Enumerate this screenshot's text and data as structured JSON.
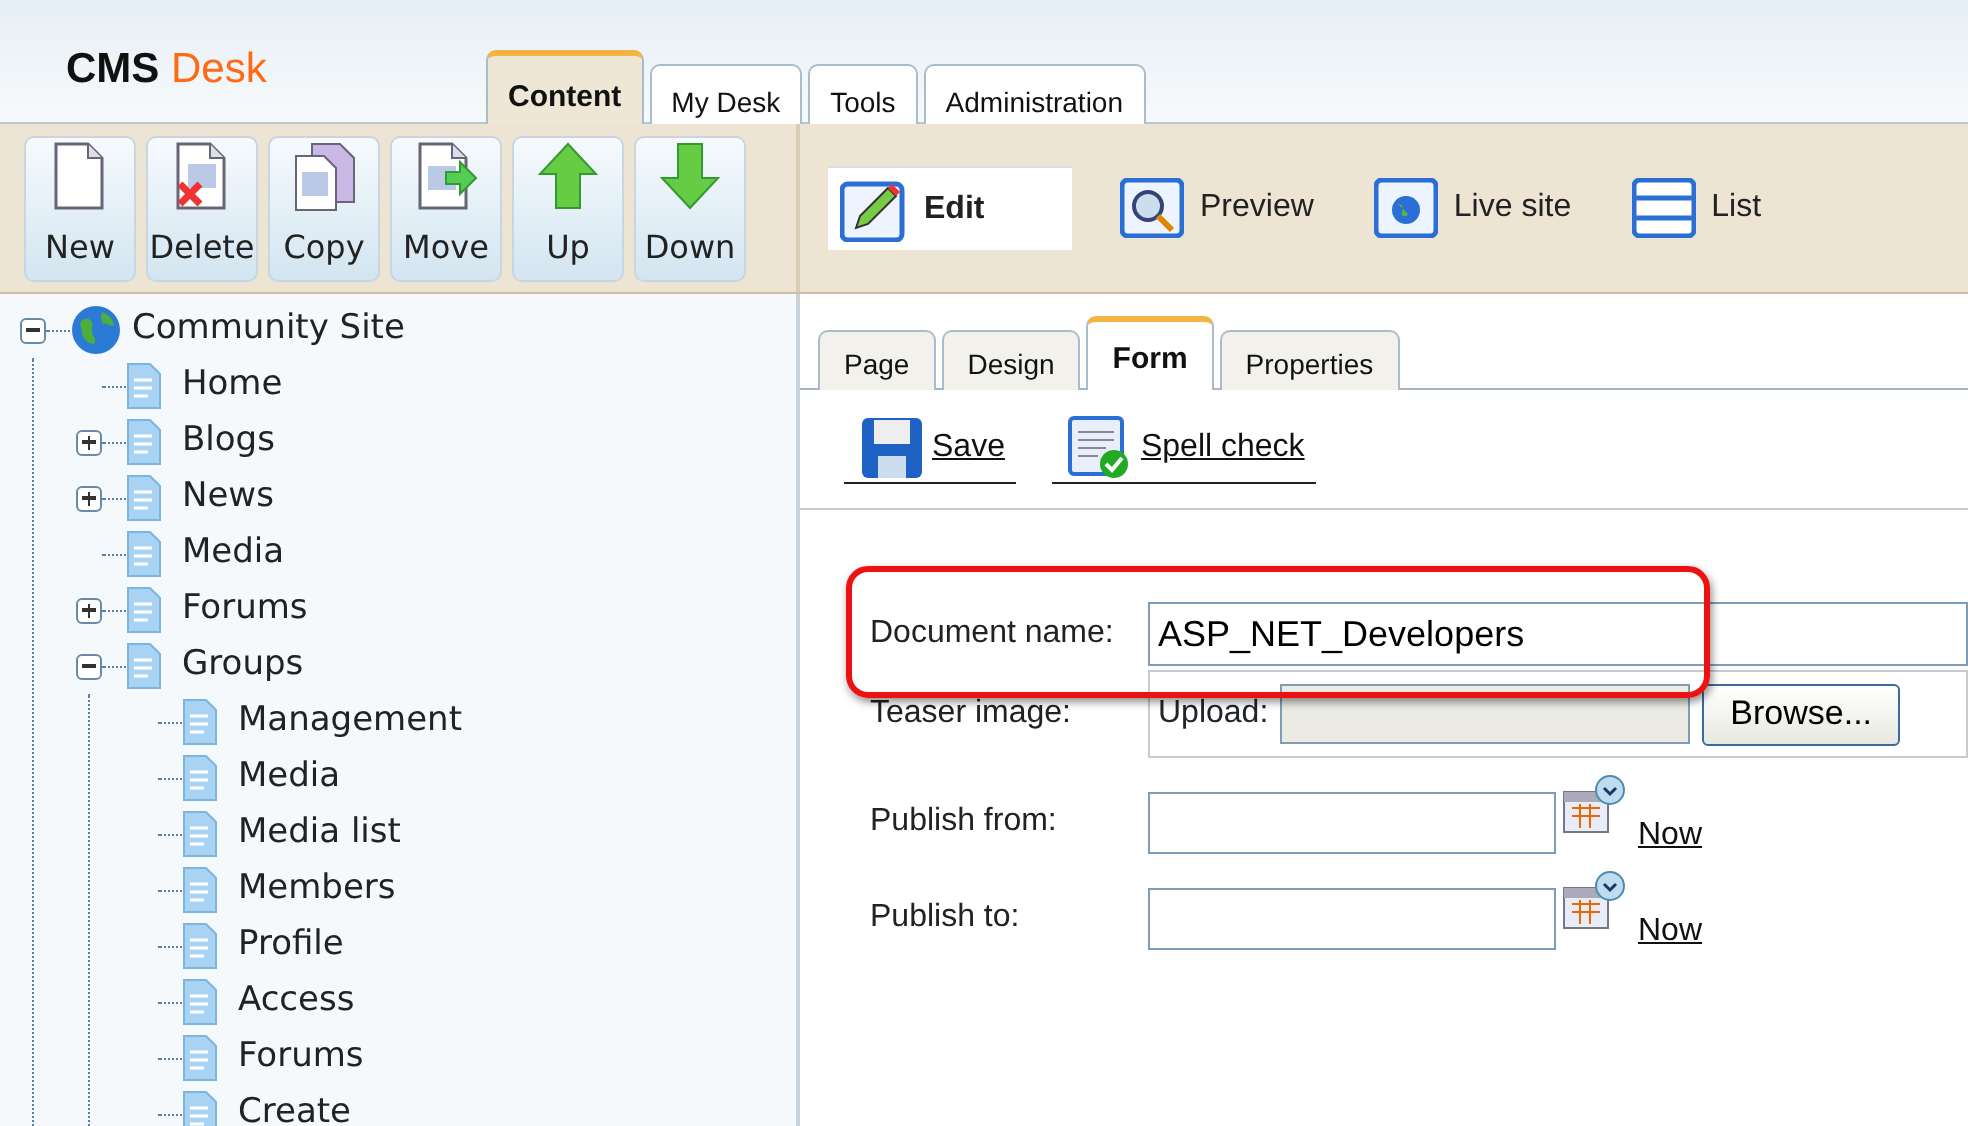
{
  "header": {
    "logo": {
      "part_1": "CMS",
      "part_2": "Desk"
    },
    "tabs": [
      {
        "label": "Content",
        "selected": true
      },
      {
        "label": "My Desk",
        "selected": false
      },
      {
        "label": "Tools",
        "selected": false
      },
      {
        "label": "Administration",
        "selected": false
      }
    ]
  },
  "toolbar": {
    "buttons": [
      {
        "label": "New",
        "kind": "new"
      },
      {
        "label": "Delete",
        "kind": "delete"
      },
      {
        "label": "Copy",
        "kind": "copy"
      },
      {
        "label": "Move",
        "kind": "move"
      },
      {
        "label": "Up",
        "kind": "up"
      },
      {
        "label": "Down",
        "kind": "down"
      }
    ],
    "view_modes": [
      {
        "label": "Edit",
        "kind": "edit",
        "selected": true
      },
      {
        "label": "Preview",
        "kind": "preview",
        "selected": false
      },
      {
        "label": "Live site",
        "kind": "live",
        "selected": false
      },
      {
        "label": "List",
        "kind": "list",
        "selected": false
      }
    ]
  },
  "tree": [
    {
      "label": "Community Site",
      "kind": "site",
      "expanded": true,
      "children": [
        {
          "label": "Home",
          "kind": "page"
        },
        {
          "label": "Blogs",
          "kind": "page",
          "expanded": false
        },
        {
          "label": "News",
          "kind": "page",
          "expanded": false
        },
        {
          "label": "Media",
          "kind": "page"
        },
        {
          "label": "Forums",
          "kind": "page",
          "expanded": false
        },
        {
          "label": "Groups",
          "kind": "page",
          "expanded": true,
          "children": [
            {
              "label": "Management",
              "kind": "page"
            },
            {
              "label": "Media",
              "kind": "page"
            },
            {
              "label": "Media list",
              "kind": "page"
            },
            {
              "label": "Members",
              "kind": "page"
            },
            {
              "label": "Profile",
              "kind": "page"
            },
            {
              "label": "Access",
              "kind": "page"
            },
            {
              "label": "Forums",
              "kind": "page"
            },
            {
              "label": "Create",
              "kind": "page"
            }
          ]
        }
      ]
    }
  ],
  "content_tabs": [
    {
      "label": "Page",
      "selected": false
    },
    {
      "label": "Design",
      "selected": false
    },
    {
      "label": "Form",
      "selected": true
    },
    {
      "label": "Properties",
      "selected": false
    }
  ],
  "actions": [
    {
      "label": "Save",
      "kind": "save"
    },
    {
      "label": "Spell check",
      "kind": "spellcheck"
    }
  ],
  "form": {
    "fields": [
      {
        "label": "Document name:",
        "kind": "text",
        "value": "ASP_NET_Developers",
        "highlighted": true
      },
      {
        "label": "Teaser image:",
        "kind": "upload",
        "upload_label": "Upload:",
        "button": "Browse...",
        "highlighted": false
      },
      {
        "label": "Publish from:",
        "kind": "date",
        "link": "Now",
        "highlighted": false
      },
      {
        "label": "Publish to:",
        "kind": "date",
        "link": "Now",
        "highlighted": false
      }
    ]
  }
}
